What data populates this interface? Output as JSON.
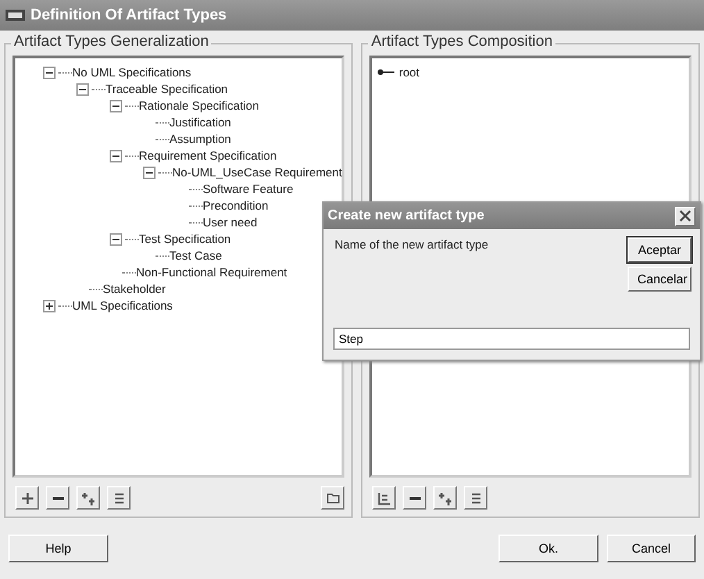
{
  "window": {
    "title": "Definition Of Artifact Types"
  },
  "generalization": {
    "title": "Artifact Types Generalization",
    "tree": [
      {
        "label": "No UML Specifications",
        "expanded": true,
        "children": [
          {
            "label": "Traceable Specification",
            "expanded": true,
            "children": [
              {
                "label": "Rationale Specification",
                "expanded": true,
                "children": [
                  {
                    "label": "Justification"
                  },
                  {
                    "label": "Assumption"
                  }
                ]
              },
              {
                "label": "Requirement Specification",
                "expanded": true,
                "children": [
                  {
                    "label": "No-UML_UseCase Requirement",
                    "expanded": true,
                    "children": [
                      {
                        "label": "Software Feature"
                      },
                      {
                        "label": "Precondition"
                      },
                      {
                        "label": "User need"
                      }
                    ]
                  }
                ]
              },
              {
                "label": "Test Specification",
                "expanded": true,
                "children": [
                  {
                    "label": "Test Case"
                  }
                ]
              },
              {
                "label": "Non-Functional Requirement"
              }
            ]
          },
          {
            "label": "Stakeholder"
          }
        ]
      },
      {
        "label": "UML Specifications",
        "expanded": false
      }
    ]
  },
  "composition": {
    "title": "Artifact Types Composition",
    "root": "root"
  },
  "dialog": {
    "title": "Create new artifact type",
    "prompt": "Name of the new artifact type",
    "value": "Step",
    "buttons": [
      "Aceptar",
      "Cancelar"
    ]
  },
  "buttons": {
    "help": "Help",
    "ok": "Ok.",
    "cancel": "Cancel"
  }
}
